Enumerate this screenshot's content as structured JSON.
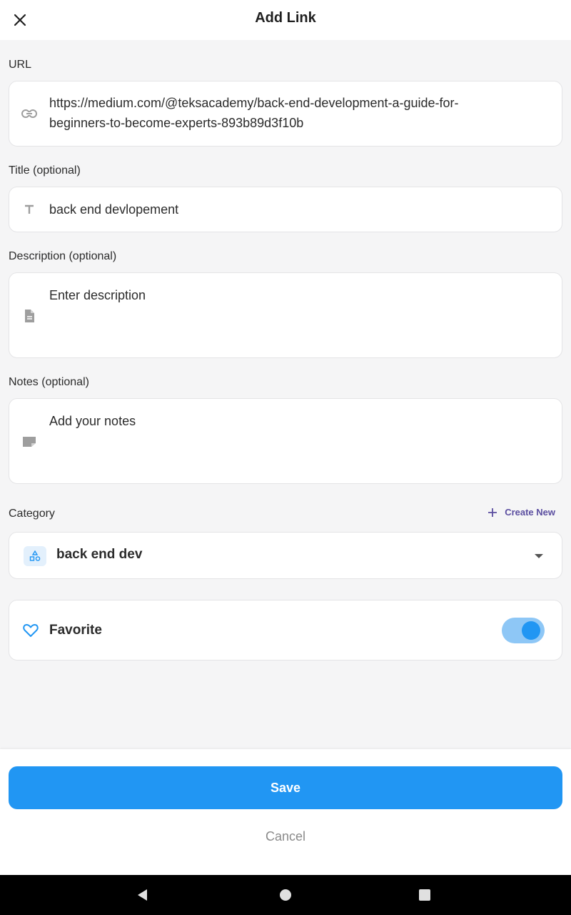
{
  "header": {
    "title": "Add Link",
    "close_icon": "close-icon"
  },
  "url": {
    "label": "URL",
    "line1": "https://medium.com/@teksacademy/back-end-development-a-guide-for-",
    "line2": "beginners-to-become-experts-893b89d3f10b",
    "icon": "link-icon"
  },
  "title_field": {
    "label": "Title (optional)",
    "value": "back end devlopement",
    "icon": "text-icon"
  },
  "description": {
    "label": "Description (optional)",
    "placeholder": "Enter description",
    "icon": "document-icon"
  },
  "notes": {
    "label": "Notes (optional)",
    "placeholder": "Add your notes",
    "icon": "note-icon"
  },
  "category": {
    "label": "Category",
    "create_new": "Create New",
    "selected": "back end dev",
    "icon": "category-icon"
  },
  "favorite": {
    "label": "Favorite",
    "enabled": true,
    "icon": "heart-icon"
  },
  "actions": {
    "save": "Save",
    "cancel": "Cancel"
  },
  "colors": {
    "accent": "#2196f3",
    "create_new": "#5b4ea0",
    "background": "#f5f5f6"
  }
}
